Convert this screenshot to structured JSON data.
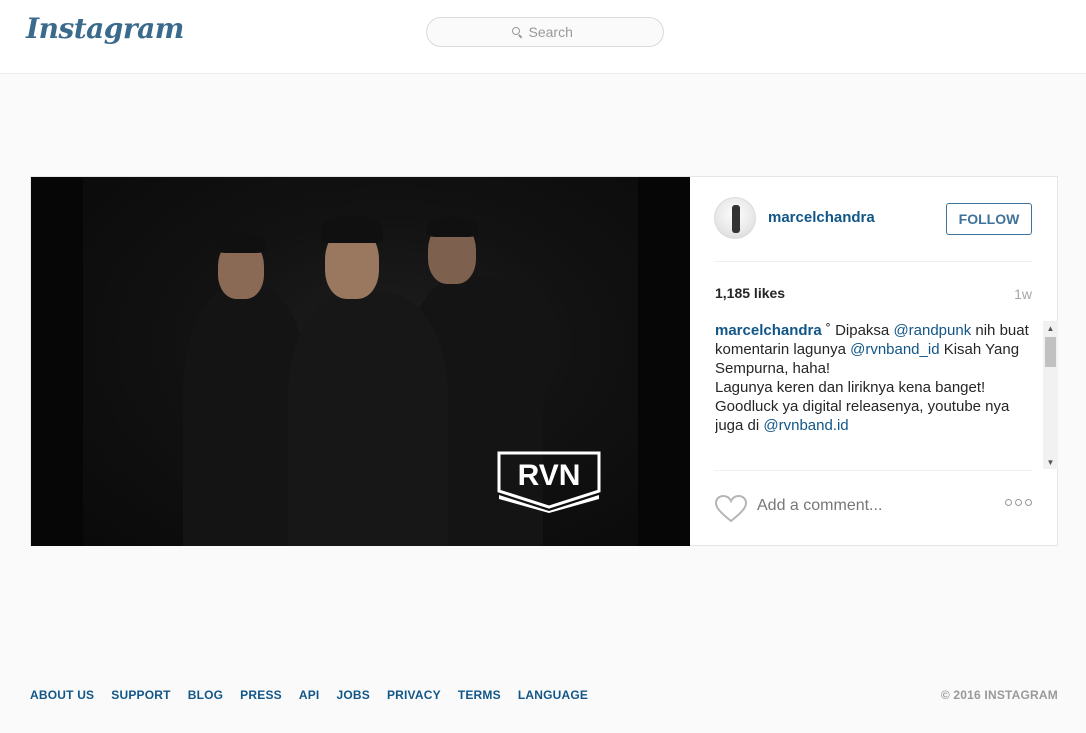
{
  "header": {
    "logo": "Instagram",
    "search_placeholder": "Search"
  },
  "post": {
    "username": "marcelchandra",
    "follow_label": "FOLLOW",
    "likes": "1,185 likes",
    "age": "1w",
    "photo_logo": "RVN",
    "caption": {
      "username": "marcelchandra",
      "part1": " ˚ Dipaksa ",
      "mention1": "@randpunk",
      "part2": " nih buat komentarin lagunya ",
      "mention2": "@rvnband_id",
      "part3": " Kisah Yang Sempurna, haha!",
      "part4": "Lagunya keren dan liriknya kena banget! Goodluck ya digital releasenya, youtube nya juga di ",
      "mention3": "@rvnband.id"
    },
    "add_comment_placeholder": "Add a comment..."
  },
  "footer": {
    "links": [
      "ABOUT US",
      "SUPPORT",
      "BLOG",
      "PRESS",
      "API",
      "JOBS",
      "PRIVACY",
      "TERMS",
      "LANGUAGE"
    ],
    "copyright": "© 2016 INSTAGRAM"
  },
  "colors": {
    "link_blue": "#125688",
    "follow_blue": "#3f729b",
    "background": "#fafafa"
  }
}
